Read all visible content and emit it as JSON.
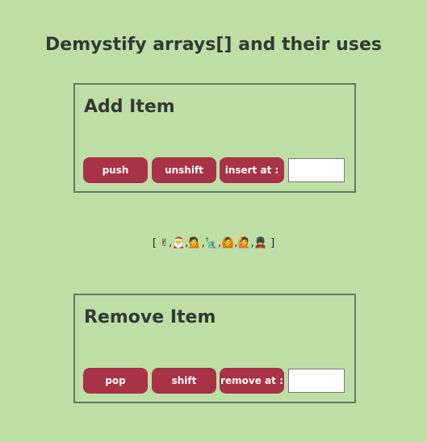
{
  "title": "Demystify arrays[] and their uses",
  "add_panel": {
    "heading": "Add Item",
    "push_label": "push",
    "unshift_label": "unshift",
    "insert_label": "insert at :",
    "index_value": ""
  },
  "array": {
    "open_bracket": "[",
    "items": [
      "✌",
      "🎅",
      "💁",
      "🗽",
      "🙆",
      "🙋",
      "💂"
    ],
    "close_bracket": "]"
  },
  "remove_panel": {
    "heading": "Remove Item",
    "pop_label": "pop",
    "shift_label": "shift",
    "remove_label": "remove at :",
    "index_value": ""
  },
  "colors": {
    "background": "#bddfa6",
    "button": "#a83246",
    "border": "#5e7b63"
  }
}
